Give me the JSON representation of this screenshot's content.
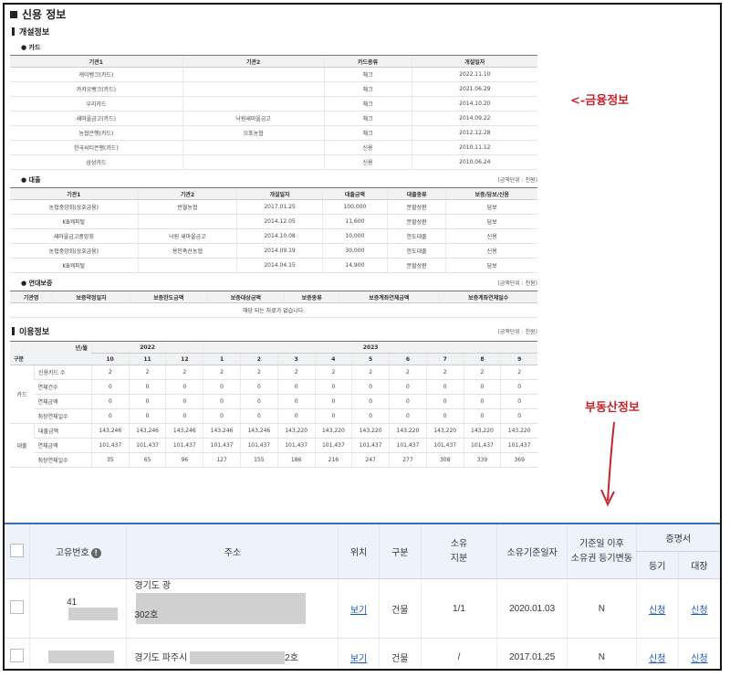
{
  "report": {
    "title": "신용 정보",
    "open_section": "개설정보",
    "card": {
      "label": "카드",
      "headers": [
        "기관1",
        "기관2",
        "카드종류",
        "개설일자"
      ],
      "rows": [
        [
          "케이뱅크(카드)",
          "",
          "체크",
          "2022.11.10"
        ],
        [
          "카카오뱅크(카드)",
          "",
          "체크",
          "2021.06.29"
        ],
        [
          "우리카드",
          "",
          "체크",
          "2014.10.20"
        ],
        [
          "새마을금고(카드)",
          "낙원새마을금고",
          "체크",
          "2014.09.22"
        ],
        [
          "농협은행(카드)",
          "오포농협",
          "체크",
          "2012.12.28"
        ],
        [
          "한국씨티은행(카드)",
          "",
          "신용",
          "2010.11.12"
        ],
        [
          "삼성카드",
          "",
          "신용",
          "2010.06.24"
        ]
      ]
    },
    "loan": {
      "label": "대출",
      "unit": "(금액단위 : 천원)",
      "headers": [
        "기관1",
        "기관2",
        "개설일자",
        "대출금액",
        "대출종류",
        "보증/담보/신용"
      ],
      "rows": [
        [
          "농협중앙회(상호금융)",
          "반월농협",
          "2017.01.25",
          "100,000",
          "분할상환",
          "담보"
        ],
        [
          "KB캐피탈",
          "",
          "2014.12.05",
          "11,600",
          "분할상환",
          "담보"
        ],
        [
          "새마을금고중앙회",
          "낙원 새마을금고",
          "2014.10.08",
          "10,000",
          "한도대출",
          "신용"
        ],
        [
          "농협중앙회(상호금융)",
          "용인축산농협",
          "2014.09.19",
          "30,000",
          "한도대출",
          "신용"
        ],
        [
          "KB캐피탈",
          "",
          "2014.04.15",
          "14,900",
          "분할상환",
          "담보"
        ]
      ]
    },
    "guarantee": {
      "label": "연대보증",
      "unit": "(금액단위 : 천원)",
      "headers": [
        "기관명",
        "보증약정일자",
        "보증한도금액",
        "보증대상금액",
        "보증종류",
        "보증계좌연체금액",
        "보증계좌연체일수"
      ],
      "empty": "해당 되는 자료가 없습니다."
    },
    "usage": {
      "title": "이용정보",
      "unit": "(금액단위 : 천원)",
      "corner_top": "년/월",
      "corner_bottom": "구분",
      "years": [
        "2022",
        "2023"
      ],
      "months": [
        "10",
        "11",
        "12",
        "1",
        "2",
        "3",
        "4",
        "5",
        "6",
        "7",
        "8",
        "9"
      ],
      "groups": [
        {
          "name": "카드",
          "rows": [
            {
              "label": "신용카드 수",
              "values": [
                "2",
                "2",
                "2",
                "2",
                "2",
                "2",
                "2",
                "2",
                "2",
                "2",
                "2",
                "2"
              ]
            },
            {
              "label": "연체건수",
              "values": [
                "0",
                "0",
                "0",
                "0",
                "0",
                "0",
                "0",
                "0",
                "0",
                "0",
                "0",
                "0"
              ]
            },
            {
              "label": "연체금액",
              "values": [
                "0",
                "0",
                "0",
                "0",
                "0",
                "0",
                "0",
                "0",
                "0",
                "0",
                "0",
                "0"
              ]
            },
            {
              "label": "최장연체일수",
              "values": [
                "0",
                "0",
                "0",
                "0",
                "0",
                "0",
                "0",
                "0",
                "0",
                "0",
                "0",
                "0"
              ]
            }
          ]
        },
        {
          "name": "대출",
          "rows": [
            {
              "label": "대출금액",
              "values": [
                "143,246",
                "143,246",
                "143,246",
                "143,246",
                "143,246",
                "143,220",
                "143,220",
                "143,220",
                "143,220",
                "143,220",
                "143,220",
                "143,220"
              ]
            },
            {
              "label": "연체금액",
              "values": [
                "101,437",
                "101,437",
                "101,437",
                "101,437",
                "101,437",
                "101,437",
                "101,437",
                "101,437",
                "101,437",
                "101,437",
                "101,437",
                "101,437"
              ]
            },
            {
              "label": "최장연체일수",
              "values": [
                "35",
                "65",
                "96",
                "127",
                "155",
                "186",
                "216",
                "247",
                "277",
                "308",
                "339",
                "369"
              ]
            }
          ]
        }
      ]
    }
  },
  "annotations": {
    "finance": "<-금융정보",
    "realestate": "부동산정보"
  },
  "property": {
    "headers": {
      "id": "고유번호",
      "address": "주소",
      "location": "위치",
      "type": "구분",
      "share": "소유\n지분",
      "base_date": "소유기준일자",
      "change": "기준일 이후\n소유권 등기변동",
      "cert": "증명서",
      "cert_reg": "등기",
      "cert_ledger": "대장"
    },
    "rows": [
      {
        "id": "41",
        "addr_prefix": "경기도 광",
        "addr_line2": "302호",
        "addr_suffix": "",
        "location": "보기",
        "type": "건물",
        "share": "1/1",
        "base_date": "2020.01.03",
        "change": "N",
        "reg": "신청",
        "ledger": "신청"
      },
      {
        "id": "",
        "addr_prefix": "경기도 파주시 ",
        "addr_line2": "",
        "addr_suffix": "2호",
        "location": "보기",
        "type": "건물",
        "share": "/",
        "base_date": "2017.01.25",
        "change": "N",
        "reg": "신청",
        "ledger": "신청"
      }
    ]
  }
}
